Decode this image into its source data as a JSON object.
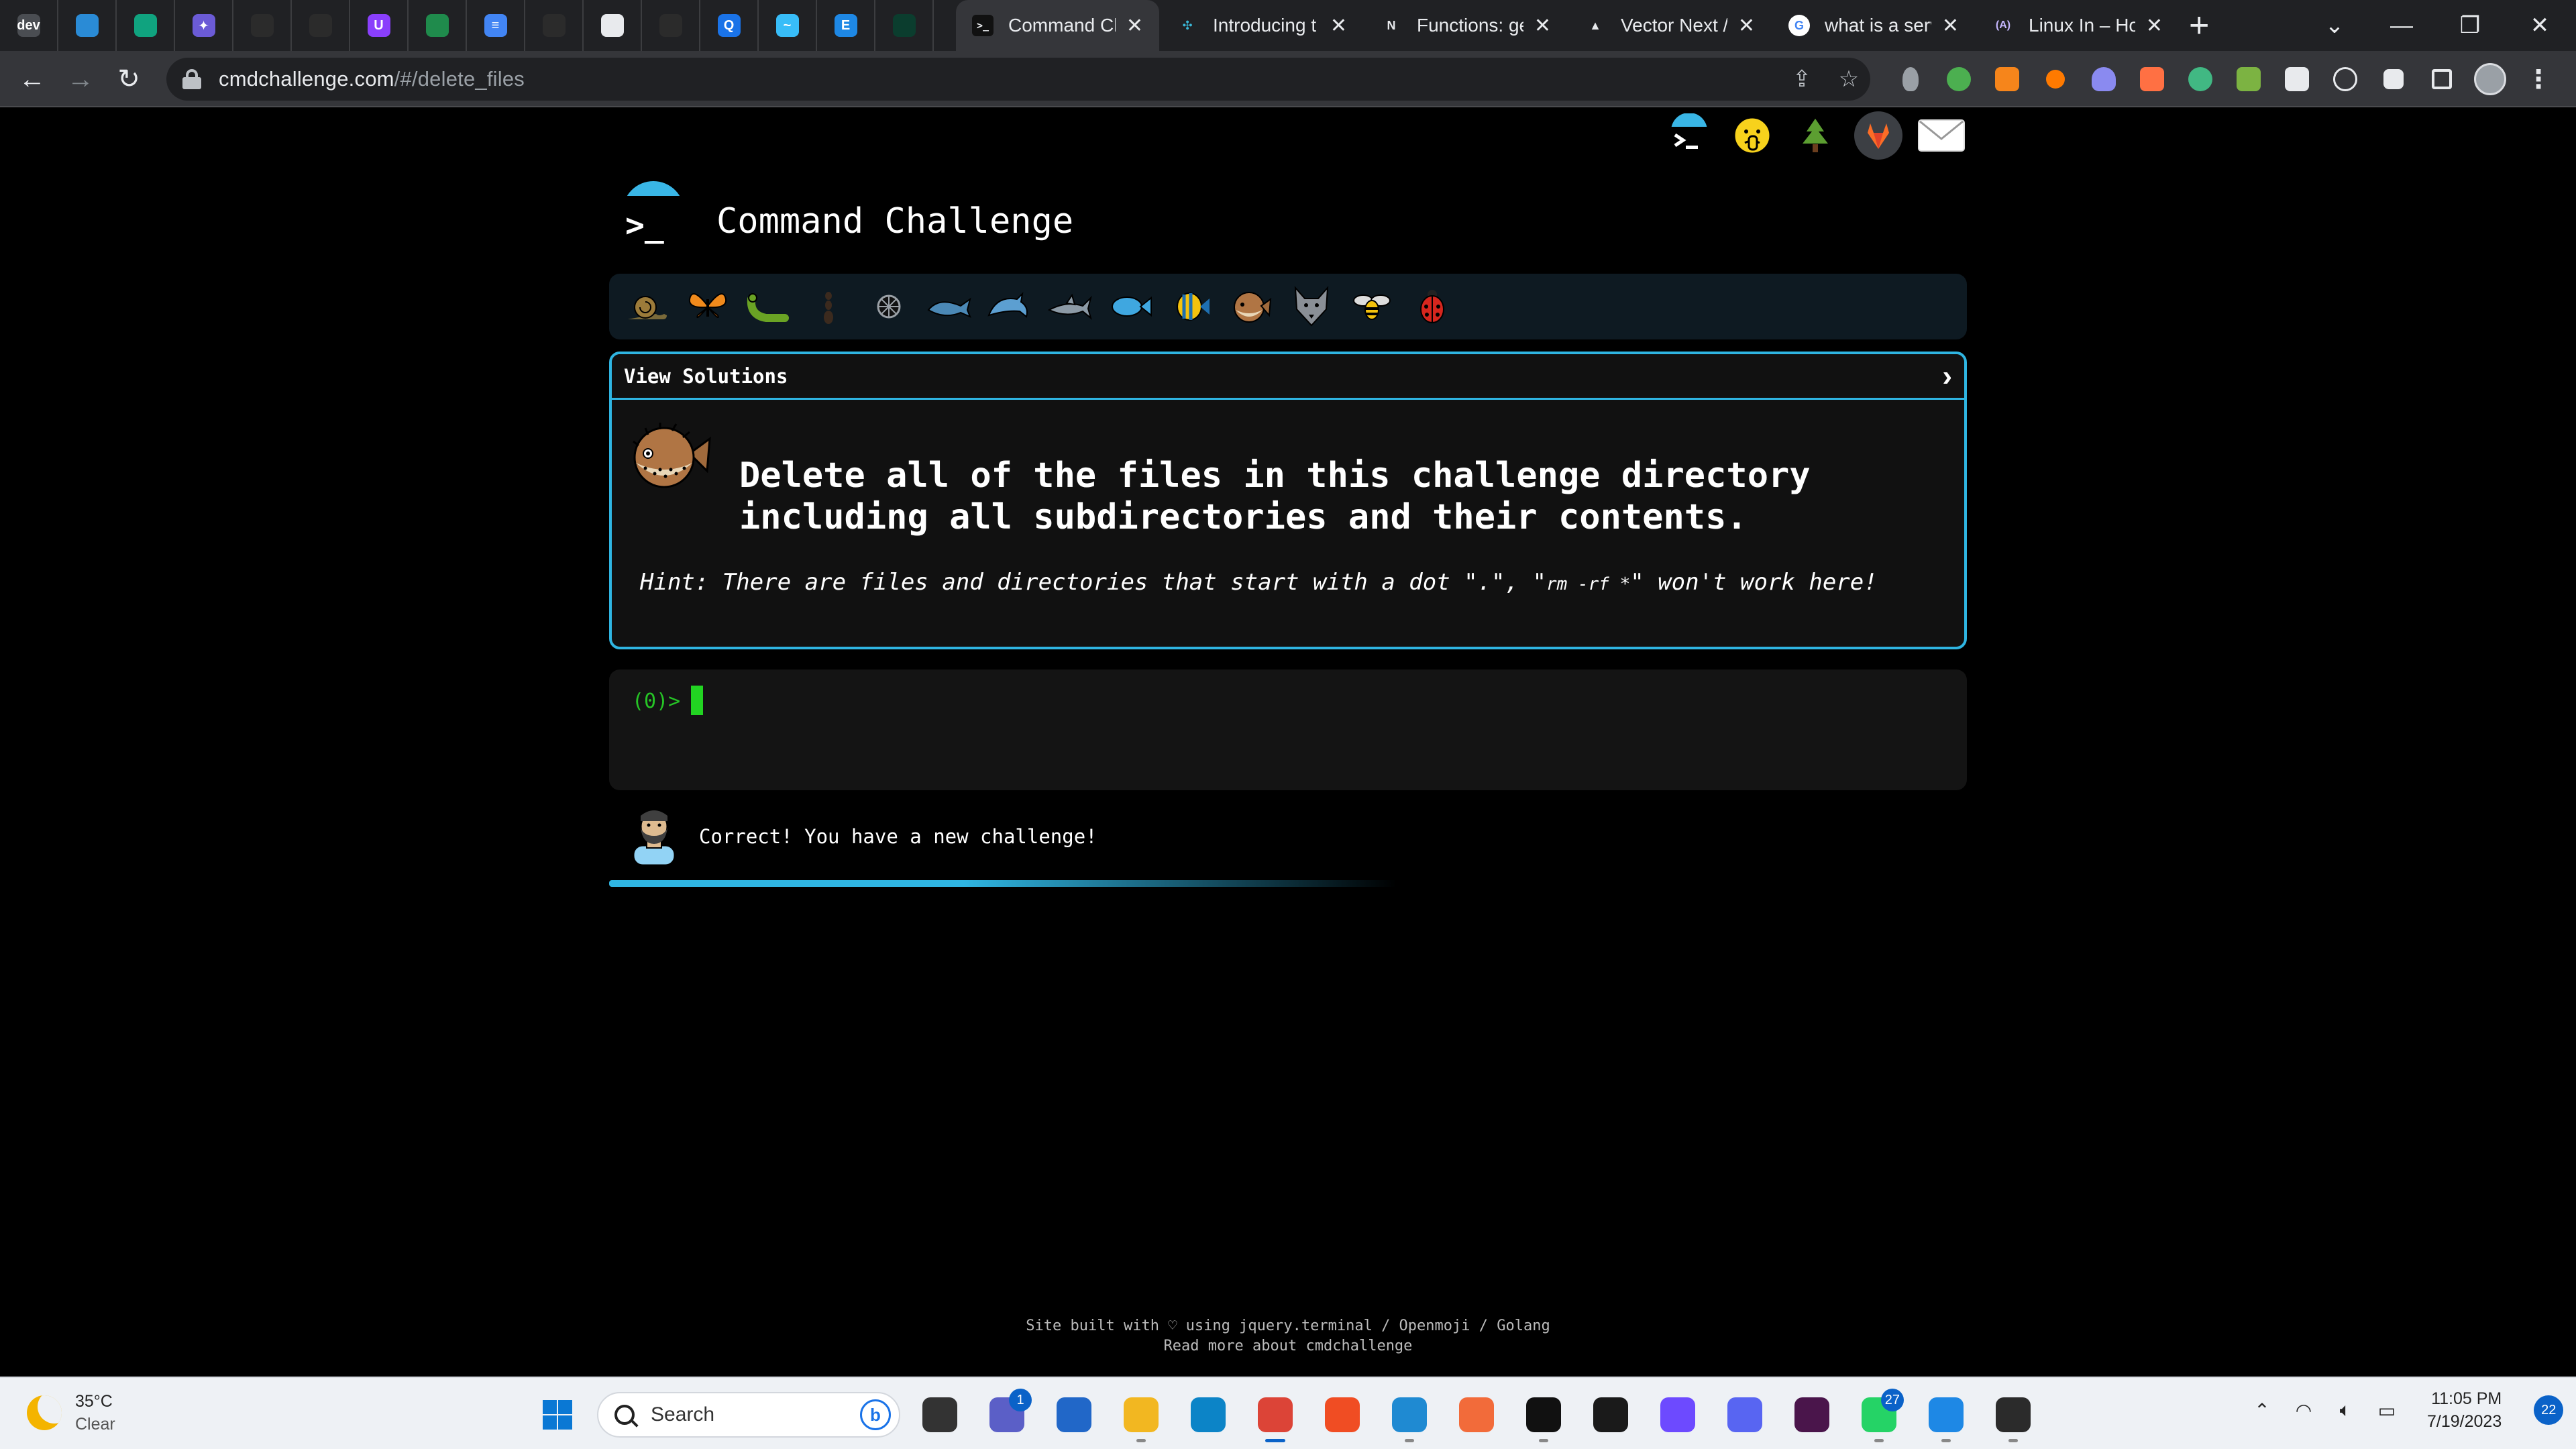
{
  "browser": {
    "pinned_tabs": [
      {
        "icon": "dev-icon",
        "color": "#4a4d52",
        "glyph": "dev"
      },
      {
        "icon": "brain-icon",
        "color": "#2a8bd6",
        "glyph": ""
      },
      {
        "icon": "openai-icon",
        "color": "#10a37f",
        "glyph": ""
      },
      {
        "icon": "sparkle-icon",
        "color": "#6b5bd6",
        "glyph": "✦"
      },
      {
        "icon": "github-icon",
        "color": "#2b2b2b",
        "glyph": ""
      },
      {
        "icon": "github-icon",
        "color": "#2b2b2b",
        "glyph": ""
      },
      {
        "icon": "u-icon",
        "color": "#8a3ffc",
        "glyph": "U"
      },
      {
        "icon": "bottle-icon",
        "color": "#1f8b4c",
        "glyph": ""
      },
      {
        "icon": "docs-icon",
        "color": "#4285f4",
        "glyph": "≡"
      },
      {
        "icon": "github-icon",
        "color": "#2b2b2b",
        "glyph": ""
      },
      {
        "icon": "search-doc-icon",
        "color": "#e8eaed",
        "glyph": ""
      },
      {
        "icon": "github-icon",
        "color": "#2b2b2b",
        "glyph": ""
      },
      {
        "icon": "q-icon",
        "color": "#1a73e8",
        "glyph": "Q"
      },
      {
        "icon": "tailwind-icon",
        "color": "#38bdf8",
        "glyph": "~"
      },
      {
        "icon": "e-icon",
        "color": "#1e88e5",
        "glyph": "E"
      },
      {
        "icon": "mongodb-icon",
        "color": "#0b3d2e",
        "glyph": ""
      }
    ],
    "tabs": [
      {
        "title": "Command Ch",
        "active": true,
        "fav_color": "#111",
        "fav_glyph": ">_"
      },
      {
        "title": "Introducing t",
        "active": false,
        "fav_color": "#202124",
        "fav_glyph": "✣"
      },
      {
        "title": "Functions: ge",
        "active": false,
        "fav_color": "#202124",
        "fav_glyph": "N"
      },
      {
        "title": "Vector Next /",
        "active": false,
        "fav_color": "#202124",
        "fav_glyph": "▲"
      },
      {
        "title": "what is a serv",
        "active": false,
        "fav_color": "#ffffff",
        "fav_glyph": "G"
      },
      {
        "title": "Linux In – Ho",
        "active": false,
        "fav_color": "#202124",
        "fav_glyph": "(A)"
      }
    ],
    "url_host": "cmdchallenge.com",
    "url_path": "/#/delete_files",
    "window_controls": {
      "dropdown": "⌄",
      "minimize": "—",
      "restore": "❐",
      "close": "✕"
    }
  },
  "page": {
    "title": "Command Challenge",
    "top_links": [
      "cmdchallenge-logo-link",
      "openmoji-link",
      "tree-link",
      "gitlab-link",
      "mail-link"
    ],
    "creatures": [
      "snail",
      "butterfly",
      "caterpillar",
      "ant",
      "shell",
      "whale",
      "dolphin",
      "shark",
      "fish",
      "tropical-fish",
      "blowfish",
      "wolf",
      "bee",
      "ladybug"
    ],
    "solutions_label": "View Solutions",
    "task_text": "Delete all of the files in this challenge directory including all subdirectories and their contents.",
    "hint_prefix": "Hint: There are files and directories that start with a dot \".\", \"",
    "hint_code": "rm -rf *",
    "hint_suffix": "\" won't work here!",
    "prompt": "(0)>",
    "result_text": "Correct! You have a new challenge!",
    "progress_fraction": 0.58,
    "footer_line1": "Site built with ♡ using jquery.terminal / Openmoji / Golang",
    "footer_line2": "Read more about cmdchallenge"
  },
  "taskbar": {
    "weather_temp": "35°C",
    "weather_cond": "Clear",
    "search_placeholder": "Search",
    "apps": [
      {
        "name": "start-icon",
        "color": "#0a78d4"
      },
      {
        "name": "task-view-icon",
        "color": "#333"
      },
      {
        "name": "teams-icon",
        "color": "#5b5fc7",
        "badge": "1"
      },
      {
        "name": "store-icon",
        "color": "#2167c8"
      },
      {
        "name": "file-explorer-icon",
        "color": "#f2b721"
      },
      {
        "name": "edge-icon",
        "color": "#0c84c7"
      },
      {
        "name": "chrome-icon",
        "color": "#dc4437",
        "active": true
      },
      {
        "name": "brave-icon",
        "color": "#f04d23"
      },
      {
        "name": "vscode-icon",
        "color": "#1f8ad2"
      },
      {
        "name": "postman-icon",
        "color": "#f26b3a"
      },
      {
        "name": "terminal-app-icon",
        "color": "#111"
      },
      {
        "name": "pycharm-icon",
        "color": "#1a1a1a"
      },
      {
        "name": "proton-vpn-icon",
        "color": "#6d4aff"
      },
      {
        "name": "discord-icon",
        "color": "#5865f2"
      },
      {
        "name": "slack-icon",
        "color": "#4a154b"
      },
      {
        "name": "whatsapp-icon",
        "color": "#25d366",
        "badge": "27"
      },
      {
        "name": "notepad-icon",
        "color": "#1e88e5"
      },
      {
        "name": "windows-terminal-icon",
        "color": "#2b2b2b"
      }
    ],
    "time": "11:05 PM",
    "date": "7/19/2023",
    "notifications": "22"
  }
}
